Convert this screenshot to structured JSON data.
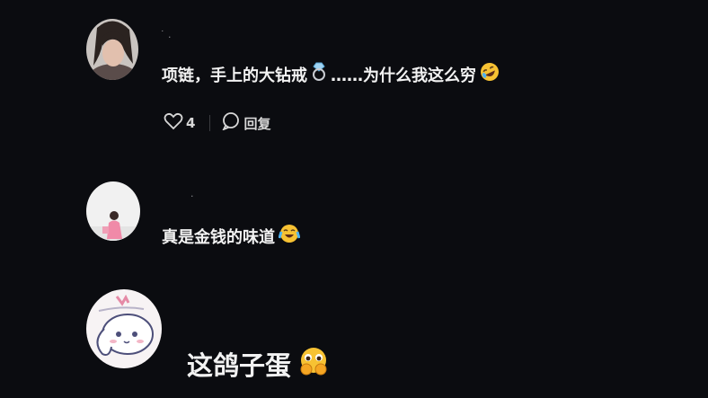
{
  "comments": [
    {
      "username": "˙ .",
      "text": "项链，手上的大钻戒",
      "emoji_mid": "ring-emoji",
      "text_after": "……为什么我这么穷",
      "emoji_end": "rolling-laugh-emoji",
      "likes": "4",
      "reply_label": "回复"
    },
    {
      "username": "·",
      "text": "真是金钱的味道",
      "emoji_end": "crying-laugh-emoji"
    },
    {
      "text": "这鸽子蛋",
      "emoji_end": "pleading-hands-emoji"
    }
  ]
}
